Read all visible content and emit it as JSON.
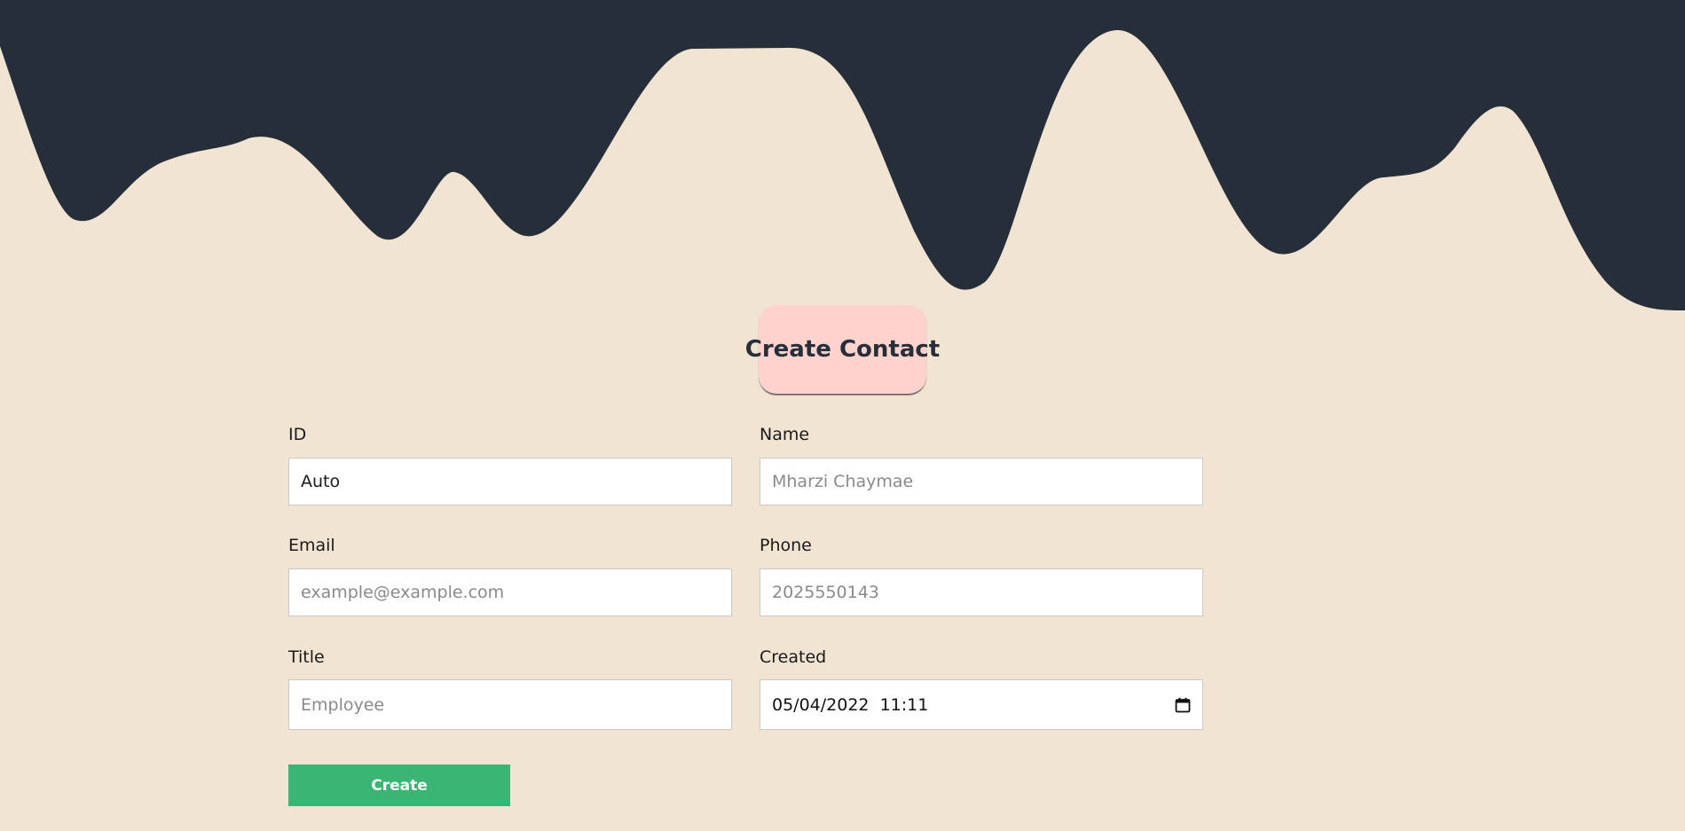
{
  "colors": {
    "background": "#f1e4d3",
    "wave": "#262f39",
    "title_badge": "#ffd3cd",
    "create_button": "#3bb573"
  },
  "header": {
    "title": "Create Contact"
  },
  "form": {
    "id": {
      "label": "ID",
      "value": "Auto"
    },
    "name": {
      "label": "Name",
      "placeholder": "Mharzi Chaymae"
    },
    "email": {
      "label": "Email",
      "placeholder": "example@example.com"
    },
    "phone": {
      "label": "Phone",
      "placeholder": "2025550143"
    },
    "title": {
      "label": "Title",
      "placeholder": "Employee"
    },
    "created": {
      "label": "Created",
      "value": "05/04/2022  11:11",
      "icon": "calendar-icon"
    },
    "submit_label": "Create"
  }
}
